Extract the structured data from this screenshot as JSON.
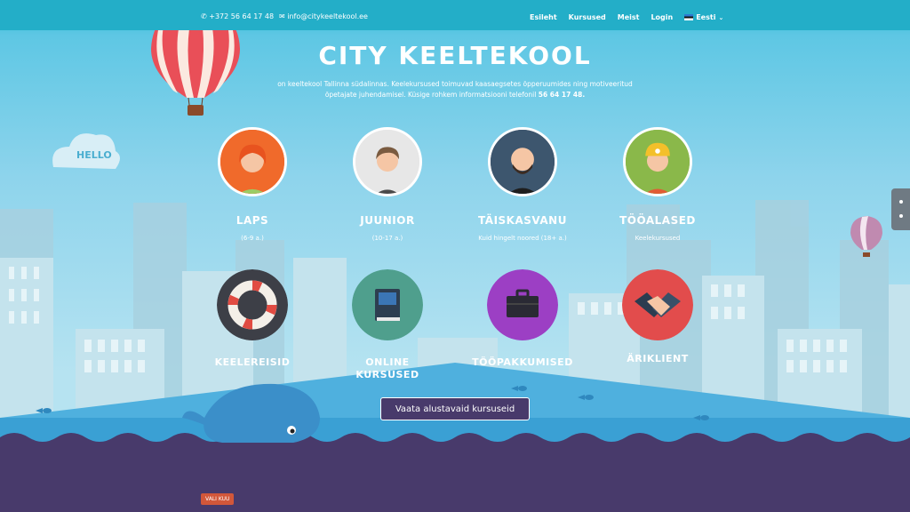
{
  "topbar": {
    "phone": "+372 56 64 17 48",
    "email": "info@citykeeltekool.ee",
    "nav": [
      "Esileht",
      "Kursused",
      "Meist",
      "Login"
    ],
    "language": "Eesti"
  },
  "hero": {
    "title": "CITY KEELTEKOOL",
    "intro_line1": "on keeltekool Tallinna südalinnas. Keelekursused toimuvad kaasaegsetes õpperuumides ning motiveeritud",
    "intro_line2": "õpetajate juhendamisel. Küsige rohkem informatsiooni telefonil",
    "intro_phone": "56 64 17 48."
  },
  "decor": {
    "cloud_text": "HELLO"
  },
  "categories": [
    {
      "title": "LAPS",
      "sub": "(6-9 a.)"
    },
    {
      "title": "JUUNIOR",
      "sub": "(10-17 a.)"
    },
    {
      "title": "TÄISKASVANU",
      "sub": "Kuid hingelt noored (18+ a.)"
    },
    {
      "title": "TÖÖALASED",
      "sub": "Keelekursused"
    }
  ],
  "services": [
    {
      "line1": "KEELEREISID",
      "line2": ""
    },
    {
      "line1": "ONLINE",
      "line2": "KURSUSED"
    },
    {
      "line1": "TÖÖPAKKUMISED",
      "line2": ""
    },
    {
      "line1": "ÄRIKLIENT",
      "line2": ""
    }
  ],
  "cta": "Vaata alustavaid kursuseid",
  "bottom": {
    "badge": "VALI KUU"
  },
  "colors": {
    "topbar": "#23aec8",
    "sea": "#4aa8d8",
    "footer": "#483a6b",
    "accent_orange": "#f06a2b"
  }
}
